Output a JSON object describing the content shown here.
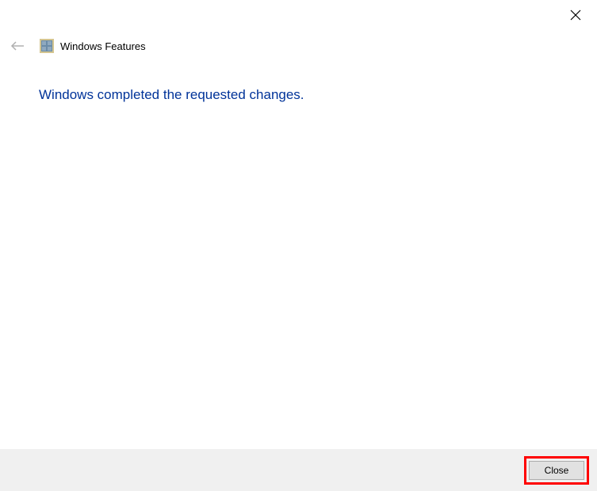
{
  "window": {
    "title": "Windows Features"
  },
  "main": {
    "message": "Windows completed the requested changes."
  },
  "footer": {
    "close_label": "Close"
  }
}
